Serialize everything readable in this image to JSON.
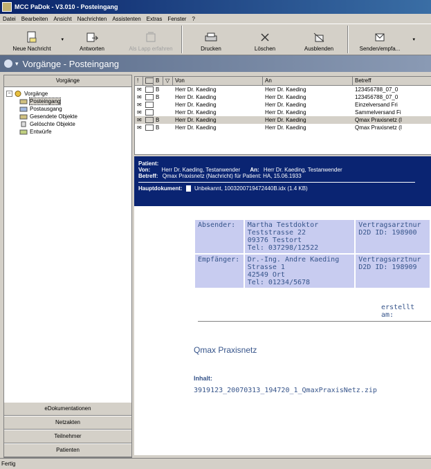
{
  "window": {
    "title": "MCC PaDok - V3.010 - Posteingang"
  },
  "menu": [
    "Datei",
    "Bearbeiten",
    "Ansicht",
    "Nachrichten",
    "Assistenten",
    "Extras",
    "Fenster",
    "?"
  ],
  "toolbar": {
    "new_message": "Neue Nachricht",
    "reply": "Antworten",
    "disabled_btn": "Als Lapp erfahren",
    "print": "Drucken",
    "delete": "Löschen",
    "hide": "Ausblenden",
    "send_receive": "Senden/empfa..."
  },
  "header": {
    "title": "Vorgänge - Posteingang"
  },
  "sidebar": {
    "heading": "Vorgänge",
    "tree": {
      "root": "Vorgänge",
      "items": [
        "Posteingang",
        "Postausgang",
        "Gesendete Objekte",
        "Gelöschte Objekte",
        "Entwürfe"
      ]
    },
    "buttons": [
      "eDokumentationen",
      "Netzakten",
      "Teilnehmer",
      "Patienten"
    ]
  },
  "list": {
    "columns": [
      "!",
      "",
      "B",
      "",
      "Von",
      "An",
      "Betreff"
    ],
    "rows": [
      {
        "b": "B",
        "from": "Herr Dr. Kaeding",
        "to": "Herr Dr. Kaeding",
        "subject": "123456788_07_0"
      },
      {
        "b": "B",
        "from": "Herr Dr. Kaeding",
        "to": "Herr Dr. Kaeding",
        "subject": "123456788_07_0"
      },
      {
        "b": "",
        "from": "Herr Dr. Kaeding",
        "to": "Herr Dr. Kaeding",
        "subject": "Einzelversand Fri"
      },
      {
        "b": "",
        "from": "Herr Dr. Kaeding",
        "to": "Herr Dr. Kaeding",
        "subject": "Sammelversand Fi"
      },
      {
        "b": "B",
        "from": "Herr Dr. Kaeding",
        "to": "Herr Dr. Kaeding",
        "subject": "Qmax Praxisnetz (I"
      },
      {
        "b": "B",
        "from": "Herr Dr. Kaeding",
        "to": "Herr Dr. Kaeding",
        "subject": "Qmax Praxisnetz (I"
      }
    ]
  },
  "preview": {
    "patient_label": "Patient:",
    "von_label": "Von:",
    "von_value": "Herr Dr. Kaeding, Testanwender",
    "an_label": "An:",
    "an_value": "Herr Dr. Kaeding, Testanwender",
    "betreff_label": "Betreff:",
    "betreff_value": "Qmax Praxisnetz (Nachricht) für Patient: HA, 15.06.1933",
    "hauptdok_label": "Hauptdokument:",
    "hauptdok_value": "Unbekannt, 1003200719472440B.idx (1.4 KB)",
    "absender_label": "Absender:",
    "absender_lines": [
      "Martha Testdoktor",
      "Teststrasse 22",
      "09376 Testort",
      "Tel: 037298/12522"
    ],
    "absender_right": [
      "Vertragsarztnur",
      "D2D ID: 198900"
    ],
    "empf_label": "Empfänger:",
    "empf_lines": [
      "Dr.-Ing. Andre Kaeding",
      "Strasse 1",
      "42549 Ort",
      "Tel: 01234/5678"
    ],
    "empf_right": [
      "Vertragsarztnur",
      "D2D ID: 198909"
    ],
    "erstellt": "erstellt am:",
    "qmax_title": "Qmax Praxisnetz",
    "inhalt_label": "Inhalt:",
    "inhalt_link": "3919123_20070313_194720_1_QmaxPraxisNetz.zip"
  },
  "status": "Fertig"
}
